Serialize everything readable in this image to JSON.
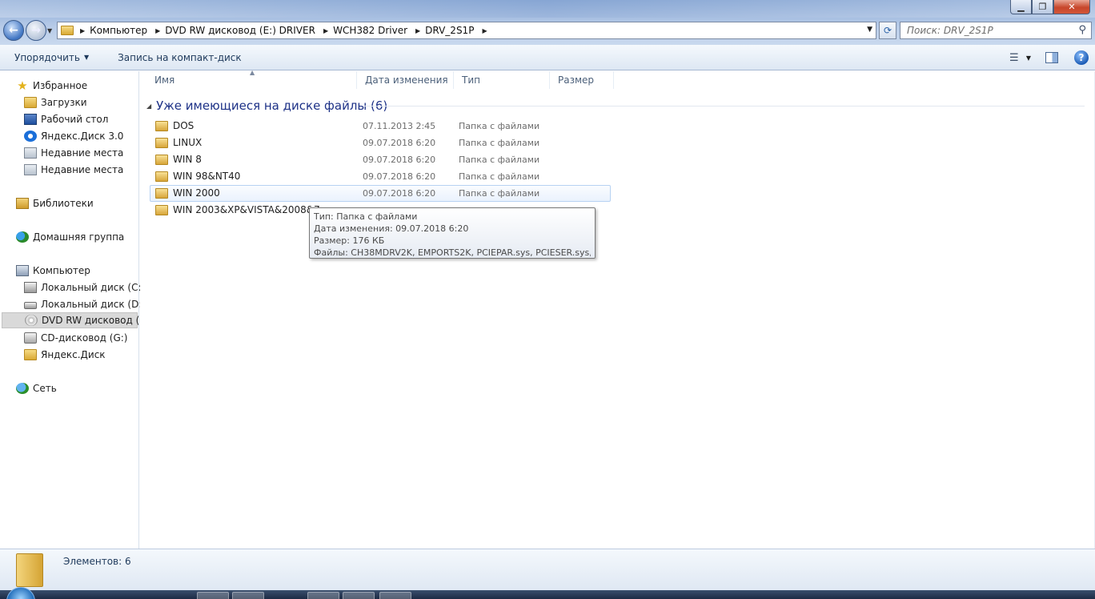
{
  "window": {
    "minimize_label": "▁",
    "maximize_label": "❐",
    "close_label": "✕"
  },
  "address": {
    "crumbs": [
      "Компьютер",
      "DVD RW дисковод (E:) DRIVER",
      "WCH382 Driver",
      "DRV_2S1P"
    ]
  },
  "search": {
    "placeholder": "Поиск: DRV_2S1P"
  },
  "toolbar": {
    "organize_label": "Упорядочить",
    "burn_label": "Запись на компакт-диск",
    "help_label": "?"
  },
  "nav": {
    "favorites": "Избранное",
    "fav_items": [
      "Загрузки",
      "Рабочий стол",
      "Яндекс.Диск 3.0",
      "Недавние места",
      "Недавние места"
    ],
    "libraries": "Библиотеки",
    "homegroup": "Домашняя группа",
    "computer": "Компьютер",
    "comp_items": [
      "Локальный диск (C:)",
      "Локальный диск (D:)",
      "DVD RW дисковод (E:)",
      "CD-дисковод (G:)",
      "Яндекс.Диск"
    ],
    "network": "Сеть"
  },
  "columns": {
    "name": "Имя",
    "date": "Дата изменения",
    "type": "Тип",
    "size": "Размер"
  },
  "group": {
    "title": "Уже имеющиеся на диске файлы (6)"
  },
  "files": [
    {
      "name": "DOS",
      "date": "07.11.2013 2:45",
      "type": "Папка с файлами"
    },
    {
      "name": "LINUX",
      "date": "09.07.2018 6:20",
      "type": "Папка с файлами"
    },
    {
      "name": "WIN 8",
      "date": "09.07.2018 6:20",
      "type": "Папка с файлами"
    },
    {
      "name": "WIN 98&NT40",
      "date": "09.07.2018 6:20",
      "type": "Папка с файлами"
    },
    {
      "name": "WIN 2000",
      "date": "09.07.2018 6:20",
      "type": "Папка с файлами"
    },
    {
      "name": "WIN 2003&XP&VISTA&2008&7",
      "date": "",
      "type": ""
    }
  ],
  "tooltip": {
    "type": "Тип: Папка с файлами",
    "date": "Дата изменения: 09.07.2018 6:20",
    "size": "Размер: 176 КБ",
    "files": "Файлы: CH38MDRV2K, EMPORTS2K, PCIEPAR.sys, PCIESER.sys, ..."
  },
  "details": {
    "count": "Элементов: 6"
  }
}
